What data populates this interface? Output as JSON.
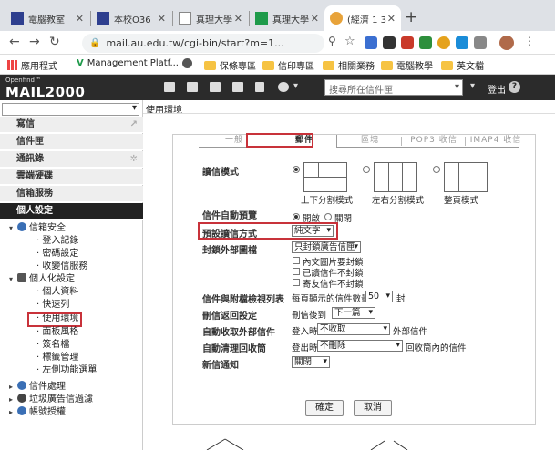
{
  "browser": {
    "tabs": [
      {
        "title": "電腦教室",
        "close": "✕",
        "favicon_color": "#2e3f8f"
      },
      {
        "title": "本校O36",
        "close": "✕",
        "favicon_color": "#2e3f8f"
      },
      {
        "title": "真理大學",
        "close": "✕",
        "favicon_color": "#888888"
      },
      {
        "title": "真理大學",
        "close": "✕",
        "favicon_color": "#1e9a4a"
      },
      {
        "title": "(經濟 1 3",
        "close": "✕",
        "favicon_color": "#e8a33a"
      }
    ],
    "new_tab": "+",
    "url": "mail.au.edu.tw/cgi-bin/start?m=1...",
    "bookmarks": [
      "應用程式",
      "Management Platf...",
      "",
      "保條專區",
      "信印專區",
      "相關業務",
      "電腦教學",
      "英文檔"
    ]
  },
  "mail": {
    "logo_small": "Openfind™",
    "logo": "MAIL2000",
    "search_placeholder": "搜尋所在信件匣",
    "search_dropdown": "▾",
    "logout": "登出",
    "help": "?",
    "breadcrumb": "使用環境"
  },
  "sidebar": {
    "items": [
      "寫信",
      "信件匣",
      "通訊錄",
      "雲端硬碟",
      "信箱服務",
      "個人設定"
    ],
    "tree": [
      {
        "label": "信箱安全",
        "toggle": "▾",
        "children": [
          "登入記錄",
          "密碼設定",
          "收變信服務"
        ]
      },
      {
        "label": "個人化設定",
        "toggle": "▾",
        "children": [
          "個人資料",
          "快速列",
          "使用環境",
          "面板風格",
          "簽名檔",
          "標籤管理",
          "左側功能選單"
        ]
      },
      {
        "label": "信件處理",
        "toggle": "▸",
        "children": []
      },
      {
        "label": "垃圾廣告信過濾",
        "toggle": "▸",
        "children": []
      },
      {
        "label": "帳號授權",
        "toggle": "▸",
        "children": []
      }
    ]
  },
  "settings": {
    "tabs": [
      "一般",
      "郵件",
      "區塊",
      "POP3 收信",
      "IMAP4 收信"
    ],
    "active_tab": "郵件",
    "read_mode": {
      "label": "讀信模式",
      "options": [
        "上下分割模式",
        "左右分割模式",
        "整頁模式"
      ]
    },
    "auto_preview": {
      "label": "信件自動預覽",
      "on": "開啟",
      "off": "關閉"
    },
    "default_read": {
      "label": "預設讀信方式",
      "value": "純文字"
    },
    "block_images": {
      "label": "封鎖外部圖檔",
      "value": "只封鎖廣告信匣",
      "checks": [
        "內文圖片要封鎖",
        "已讀信件不封鎖",
        "寄友信件不封鎖"
      ]
    },
    "list_count": {
      "label": "信件與附檔檢視列表",
      "prefix": "每頁顯示的信件數量",
      "value": "50",
      "suffix": "封"
    },
    "after_delete": {
      "label": "刪信返回設定",
      "prefix": "刪信後到",
      "value": "下一篇"
    },
    "auto_receive": {
      "label": "自動收取外部信件",
      "prefix": "登入時",
      "value": "不收取",
      "suffix": "外部信件"
    },
    "auto_clean": {
      "label": "自動清理回收筒",
      "prefix": "登出時",
      "value": "不刪除",
      "suffix": "回收筒內的信件"
    },
    "notify": {
      "label": "新信通知",
      "value": "關閉"
    },
    "ok": "確定",
    "cancel": "取消"
  }
}
